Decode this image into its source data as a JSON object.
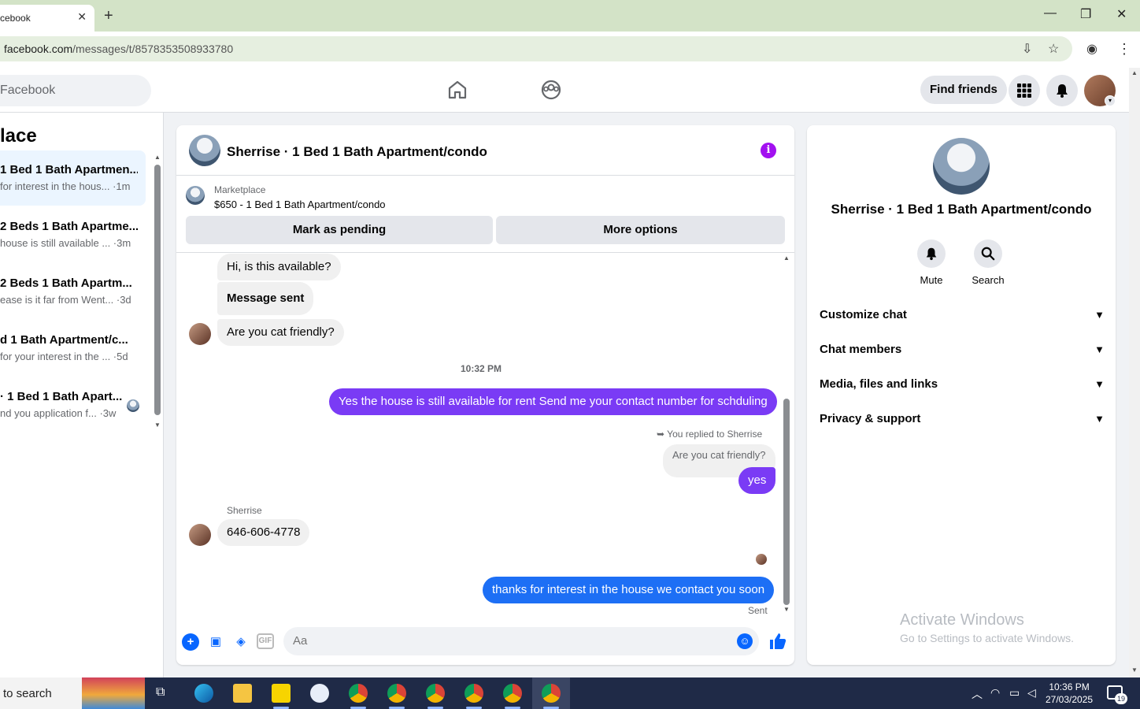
{
  "browser": {
    "tab_title": "cebook",
    "url_host": "facebook.com",
    "url_path": "/messages/t/8578353508933780"
  },
  "header": {
    "search_placeholder": "Facebook",
    "find_friends": "Find friends"
  },
  "left": {
    "title": "lace",
    "conversations": [
      {
        "name": "1 Bed 1 Bath Apartmen...",
        "preview": "for interest in the hous... ·1m",
        "active": true
      },
      {
        "name": "2 Beds 1 Bath Apartme...",
        "preview": "house is still available ... ·3m",
        "active": false
      },
      {
        "name": "2 Beds 1 Bath Apartm...",
        "preview": "ease is it far from Went... ·3d",
        "active": false
      },
      {
        "name": "d 1 Bath Apartment/c...",
        "preview": "for your interest in the ... ·5d",
        "active": false
      },
      {
        "name": "· 1 Bed 1 Bath Apart...",
        "preview": "nd you application f... ·3w",
        "active": false
      }
    ]
  },
  "chat": {
    "title": "Sherrise · 1 Bed 1 Bath Apartment/condo",
    "marketplace_label": "Marketplace",
    "listing": "$650 - 1 Bed 1 Bath Apartment/condo",
    "mark_pending": "Mark as pending",
    "more_options": "More options",
    "messages": {
      "m1": "Hi, is this available?",
      "m2": "Message sent",
      "m3": "Are you cat friendly?",
      "timestamp": "10:32 PM",
      "m4": "Yes the house is still available for rent Send me your contact number for schduling",
      "reply_note": "You replied to Sherrise",
      "reply_quote": "Are you cat friendly?",
      "m5": "yes",
      "sender": "Sherrise",
      "m6": "646-606-4778",
      "m7": "thanks for interest in the house we contact you soon",
      "status": "Sent"
    },
    "composer_placeholder": "Aa",
    "gif_label": "GIF"
  },
  "right": {
    "name": "Sherrise · 1 Bed 1 Bath Apartment/condo",
    "mute": "Mute",
    "search": "Search",
    "rows": [
      "Customize chat",
      "Chat members",
      "Media, files and links",
      "Privacy & support"
    ],
    "activate_title": "Activate Windows",
    "activate_sub": "Go to Settings to activate Windows."
  },
  "taskbar": {
    "search": "to search",
    "time": "10:36 PM",
    "date": "27/03/2025",
    "notif_count": "19"
  }
}
